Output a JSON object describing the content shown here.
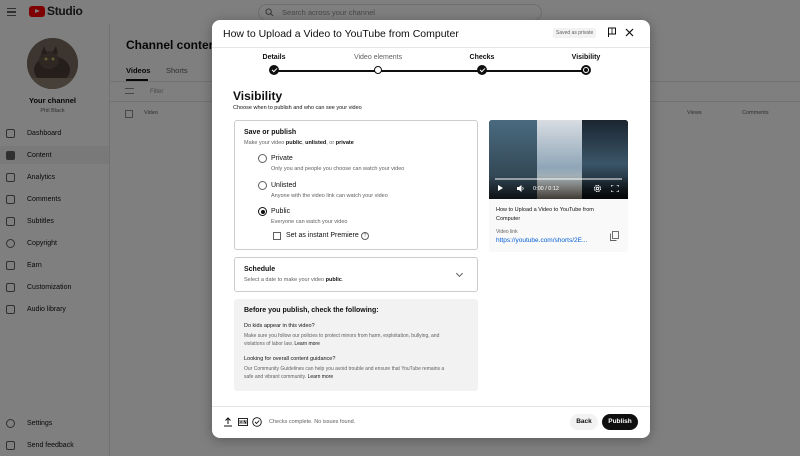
{
  "app": {
    "brand": "Studio",
    "search_placeholder": "Search across your channel"
  },
  "sidebar": {
    "channel_title": "Your channel",
    "channel_name": "Phil Black",
    "items": [
      {
        "label": "Dashboard"
      },
      {
        "label": "Content"
      },
      {
        "label": "Analytics"
      },
      {
        "label": "Comments"
      },
      {
        "label": "Subtitles"
      },
      {
        "label": "Copyright"
      },
      {
        "label": "Earn"
      },
      {
        "label": "Customization"
      },
      {
        "label": "Audio library"
      }
    ],
    "bottom_items": [
      {
        "label": "Settings"
      },
      {
        "label": "Send feedback"
      }
    ]
  },
  "main": {
    "title": "Channel content",
    "tabs": [
      {
        "label": "Videos"
      },
      {
        "label": "Shorts"
      }
    ],
    "filter_placeholder": "Filter",
    "columns": [
      "Video",
      "Views",
      "Comments"
    ]
  },
  "dialog": {
    "title": "How to Upload a Video to YouTube from Computer",
    "saved_badge": "Saved as private",
    "steps": [
      {
        "label": "Details",
        "state": "done"
      },
      {
        "label": "Video elements",
        "state": "empty"
      },
      {
        "label": "Checks",
        "state": "done"
      },
      {
        "label": "Visibility",
        "state": "current"
      }
    ],
    "section_title": "Visibility",
    "section_subtitle": "Choose when to publish and who can see your video",
    "save_publish": {
      "title": "Save or publish",
      "subtitle_prefix": "Make your video ",
      "subtitle_public": "public",
      "subtitle_sep1": ", ",
      "subtitle_unlisted": "unlisted",
      "subtitle_sep2": ", or ",
      "subtitle_private": "private",
      "options": [
        {
          "label": "Private",
          "desc": "Only you and people you choose can watch your video",
          "selected": false
        },
        {
          "label": "Unlisted",
          "desc": "Anyone with the video link can watch your video",
          "selected": false
        },
        {
          "label": "Public",
          "desc": "Everyone can watch your video",
          "selected": true
        }
      ],
      "premiere_label": "Set as instant Premiere",
      "premiere_checked": false
    },
    "schedule": {
      "title": "Schedule",
      "subtitle_prefix": "Select a date to make your video ",
      "subtitle_bold": "public",
      "subtitle_suffix": "."
    },
    "before_publish": {
      "title": "Before you publish, check the following:",
      "q1": "Do kids appear in this video?",
      "q1_text": "Make sure you follow our policies to protect minors from harm, exploitation, bullying, and violations of labor law.",
      "q1_link": "Learn more",
      "q2": "Looking for overall content guidance?",
      "q2_text": "Our Community Guidelines can help you avoid trouble and ensure that YouTube remains a safe and vibrant community.",
      "q2_link": "Learn more"
    },
    "video": {
      "time": "0:00 / 0:12",
      "name": "How to Upload a Video to YouTube from Computer",
      "link_label": "Video link",
      "link": "https://youtube.com/shorts/2E..."
    },
    "footer": {
      "status": "Checks complete. No issues found.",
      "back_label": "Back",
      "publish_label": "Publish"
    }
  },
  "colors": {
    "brand_red": "#ff0000",
    "link_blue": "#065fd4",
    "primary_dark": "#0f0f0f"
  }
}
